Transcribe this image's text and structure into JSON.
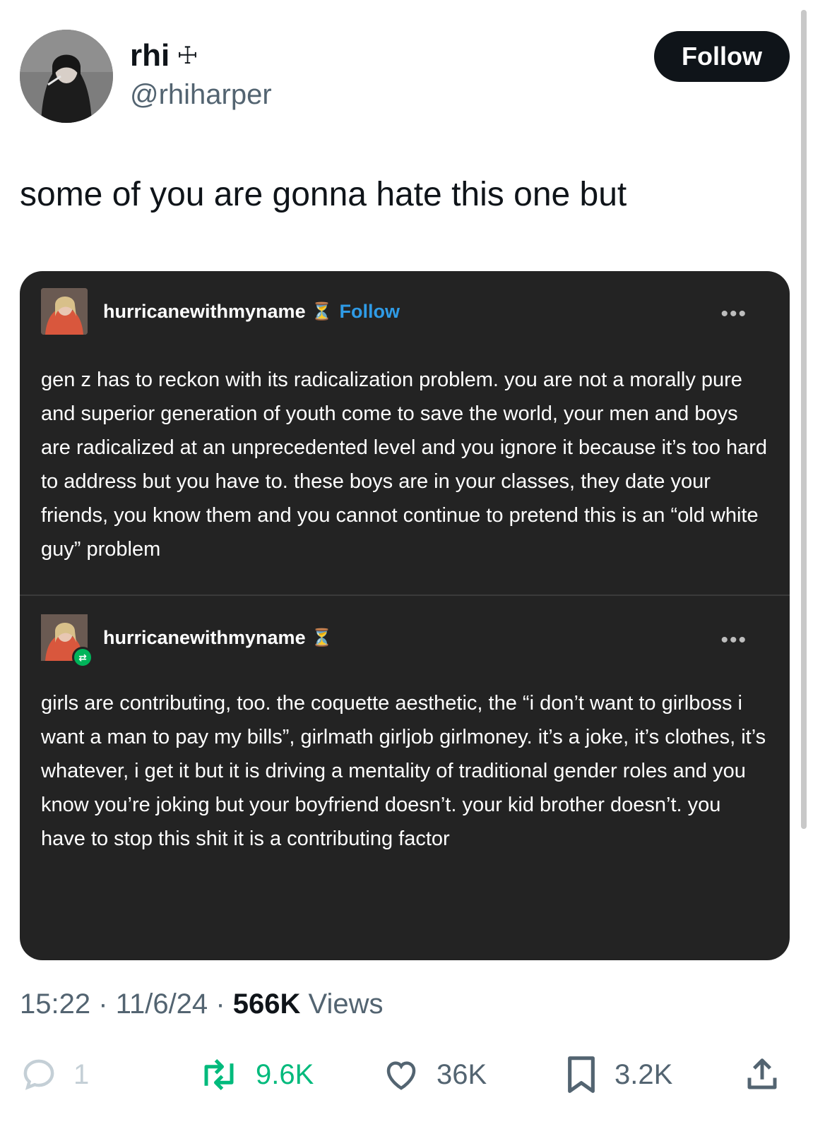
{
  "author": {
    "display_name": "rhi",
    "name_symbol": "☩",
    "handle": "@rhiharper",
    "follow_label": "Follow"
  },
  "tweet": {
    "text": "some of you are gonna hate this one but"
  },
  "embedded_posts": [
    {
      "username": "hurricanewithmyname",
      "badge_icon": "hourglass-badge-icon",
      "follow_label": "Follow",
      "more_label": "•••",
      "body": "gen z has to reckon with its radicalization problem. you are not a morally pure and superior generation of youth come to save the world, your men and boys are radicalized at an unprecedented level and you ignore it because it’s too hard to address but you have to. these boys are in your classes, they date your friends, you know them and you cannot continue to pretend this is an “old white guy” problem"
    },
    {
      "username": "hurricanewithmyname",
      "badge_icon": "hourglass-badge-icon",
      "more_label": "•••",
      "body": "girls are contributing, too. the coquette aesthetic, the “i don’t want to girlboss i want a man to pay my bills”, girlmath girljob girlmoney. it’s a joke, it’s clothes, it’s whatever, i get it but it is driving a mentality of traditional gender roles and you know you’re joking but your boyfriend doesn’t. your kid brother doesn’t. you have to stop this shit it is a contributing factor"
    }
  ],
  "meta": {
    "time": "15:22",
    "separator": "·",
    "date": "11/6/24",
    "views_count": "566K",
    "views_label": "Views"
  },
  "actions": {
    "reply_count": "1",
    "retweet_count": "9.6K",
    "like_count": "36K",
    "bookmark_count": "3.2K"
  },
  "colors": {
    "retweet": "#00ba7c",
    "embed_background": "#232323",
    "tumblr_follow": "#2f9be6"
  }
}
